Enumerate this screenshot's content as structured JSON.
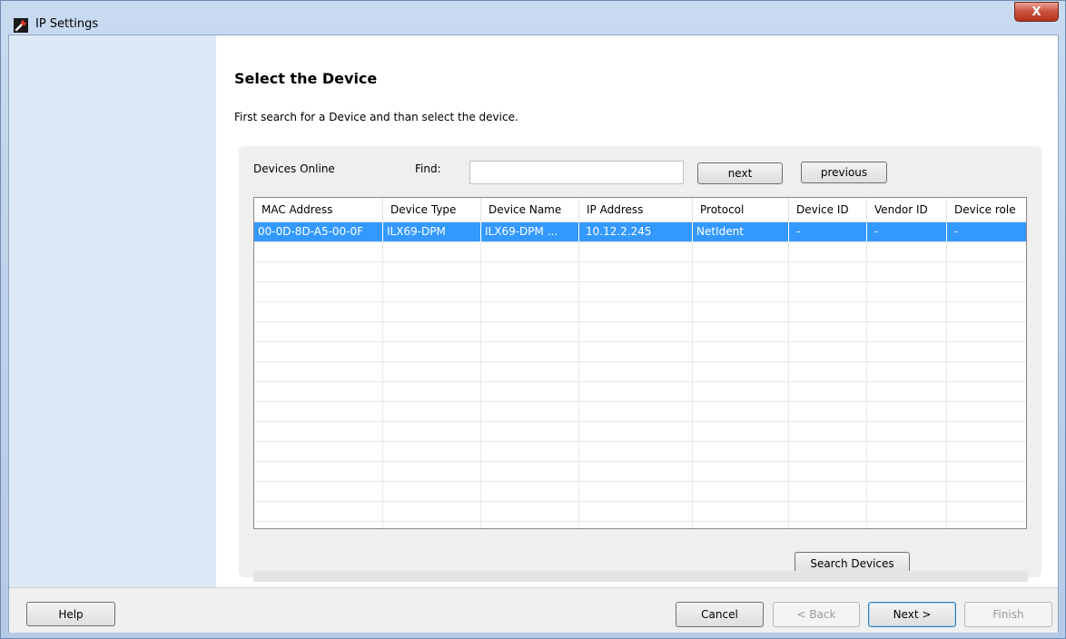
{
  "window": {
    "title": "IP Settings",
    "close_glyph": "X",
    "icon": "wrench-icon",
    "accent_color": "#3399ff"
  },
  "page": {
    "heading": "Select the Device",
    "instruction": "First search for a Device and than select the device."
  },
  "search": {
    "devices_online_label": "Devices Online",
    "find_label": "Find:",
    "find_value": "",
    "next_label": "next",
    "previous_label": "previous",
    "search_devices_label": "Search Devices"
  },
  "table": {
    "columns": [
      "MAC Address",
      "Device Type",
      "Device Name",
      "IP Address",
      "Protocol",
      "Device ID",
      "Vendor ID",
      "Device role"
    ],
    "rows": [
      {
        "selected": true,
        "cells": [
          "00-0D-8D-A5-00-0F",
          "ILX69-DPM",
          "ILX69-DPM ...",
          "10.12.2.245",
          "NetIdent",
          "-",
          "-",
          "-"
        ]
      }
    ]
  },
  "footer": {
    "help_label": "Help",
    "cancel_label": "Cancel",
    "back_label": "< Back",
    "next_label": "Next >",
    "finish_label": "Finish"
  }
}
